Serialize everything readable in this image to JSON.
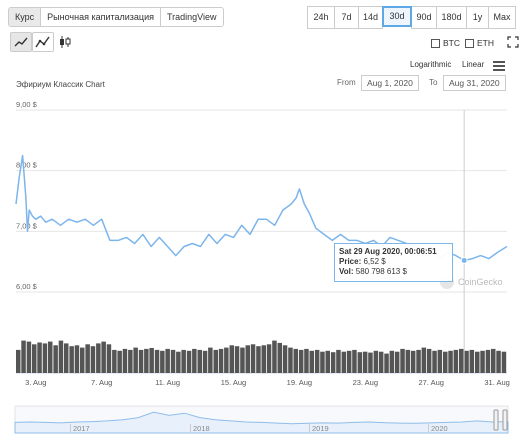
{
  "tabs": [
    "Курс",
    "Рыночная капитализация",
    "TradingView"
  ],
  "ranges": [
    "24h",
    "7d",
    "14d",
    "30d",
    "90d",
    "180d",
    "1y",
    "Max"
  ],
  "active_range": "30d",
  "checkboxes": {
    "btc": "BTC",
    "eth": "ETH"
  },
  "scale": {
    "log": "Logarithmic",
    "linear": "Linear"
  },
  "date_range": {
    "from_label": "From",
    "from": "Aug 1, 2020",
    "to_label": "To",
    "to": "Aug 31, 2020"
  },
  "tooltip": {
    "date": "Sat 29 Aug 2020, 00:06:51",
    "price_label": "Price:",
    "price": "6,52 $",
    "vol_label": "Vol:",
    "vol": "580 798 613 $"
  },
  "watermark": "CoinGecko",
  "navigator_years": [
    "2017",
    "2018",
    "2019",
    "2020"
  ],
  "colors": {
    "line": "#7cb5ec",
    "volume": "#555555",
    "accent": "#5fa8e6"
  },
  "chart_data": {
    "type": "line",
    "title": "Эфириум Классик Chart",
    "y_ticks": [
      "6,00 $",
      "7,00 $",
      "8,00 $",
      "9,00 $"
    ],
    "ylim": [
      6,
      9
    ],
    "x_ticks": [
      "3. Aug",
      "7. Aug",
      "11. Aug",
      "15. Aug",
      "19. Aug",
      "23. Aug",
      "27. Aug",
      "31. Aug"
    ],
    "x_tick_days": [
      3,
      7,
      11,
      15,
      19,
      23,
      27,
      31
    ],
    "xlim": [
      1.8,
      31.6
    ],
    "series": [
      {
        "x": [
          1.8,
          2.0,
          2.2,
          2.4,
          2.5,
          2.6,
          2.8,
          3.0,
          3.3,
          3.6,
          4.0,
          4.5,
          5.0,
          5.5,
          6.0,
          6.5,
          7.0,
          7.5,
          8.0,
          8.5,
          9.0,
          9.5,
          10.0,
          10.5,
          11.0,
          11.5,
          12.0,
          12.5,
          13.0,
          13.5,
          14.0,
          14.5,
          15.0,
          15.5,
          16.0,
          16.5,
          17.0,
          17.5,
          18.0,
          18.5,
          18.8,
          19.0,
          19.3,
          19.6,
          20.0,
          20.5,
          21.0,
          21.5,
          22.0,
          22.5,
          23.0,
          23.5,
          24.0,
          24.5,
          25.0,
          25.5,
          26.0,
          26.5,
          27.0,
          27.5,
          28.0,
          28.5,
          29.0,
          29.5,
          30.0,
          30.5,
          31.0,
          31.3,
          31.6
        ],
        "y": [
          7.45,
          7.9,
          8.25,
          7.55,
          7.0,
          7.35,
          7.25,
          7.2,
          7.25,
          7.15,
          7.2,
          7.1,
          7.2,
          7.15,
          7.2,
          7.1,
          7.2,
          6.85,
          6.85,
          6.9,
          6.8,
          6.95,
          6.75,
          6.9,
          6.75,
          6.6,
          6.75,
          6.8,
          6.75,
          6.95,
          6.8,
          6.95,
          6.9,
          7.1,
          6.95,
          7.2,
          7.2,
          7.1,
          7.35,
          7.45,
          7.55,
          7.7,
          7.45,
          7.3,
          7.05,
          6.95,
          6.85,
          6.95,
          6.85,
          6.85,
          6.8,
          6.85,
          6.75,
          6.9,
          6.85,
          6.8,
          6.75,
          6.7,
          6.75,
          6.55,
          6.65,
          6.6,
          6.52,
          6.55,
          6.6,
          6.55,
          6.65,
          6.7,
          6.75
        ]
      }
    ],
    "volume": [
      0.5,
      0.7,
      0.68,
      0.62,
      0.66,
      0.64,
      0.68,
      0.6,
      0.7,
      0.64,
      0.58,
      0.6,
      0.55,
      0.62,
      0.58,
      0.64,
      0.68,
      0.62,
      0.5,
      0.48,
      0.52,
      0.5,
      0.55,
      0.5,
      0.52,
      0.54,
      0.5,
      0.48,
      0.52,
      0.5,
      0.46,
      0.5,
      0.48,
      0.52,
      0.5,
      0.48,
      0.55,
      0.5,
      0.52,
      0.55,
      0.6,
      0.58,
      0.55,
      0.6,
      0.62,
      0.58,
      0.6,
      0.62,
      0.7,
      0.65,
      0.6,
      0.55,
      0.52,
      0.5,
      0.52,
      0.48,
      0.5,
      0.46,
      0.48,
      0.45,
      0.5,
      0.46,
      0.48,
      0.5,
      0.45,
      0.46,
      0.44,
      0.48,
      0.46,
      0.42,
      0.48,
      0.46,
      0.52,
      0.5,
      0.48,
      0.5,
      0.55,
      0.52,
      0.48,
      0.5,
      0.46,
      0.48,
      0.5,
      0.52,
      0.48,
      0.5,
      0.46,
      0.48,
      0.5,
      0.52,
      0.48,
      0.46
    ]
  }
}
